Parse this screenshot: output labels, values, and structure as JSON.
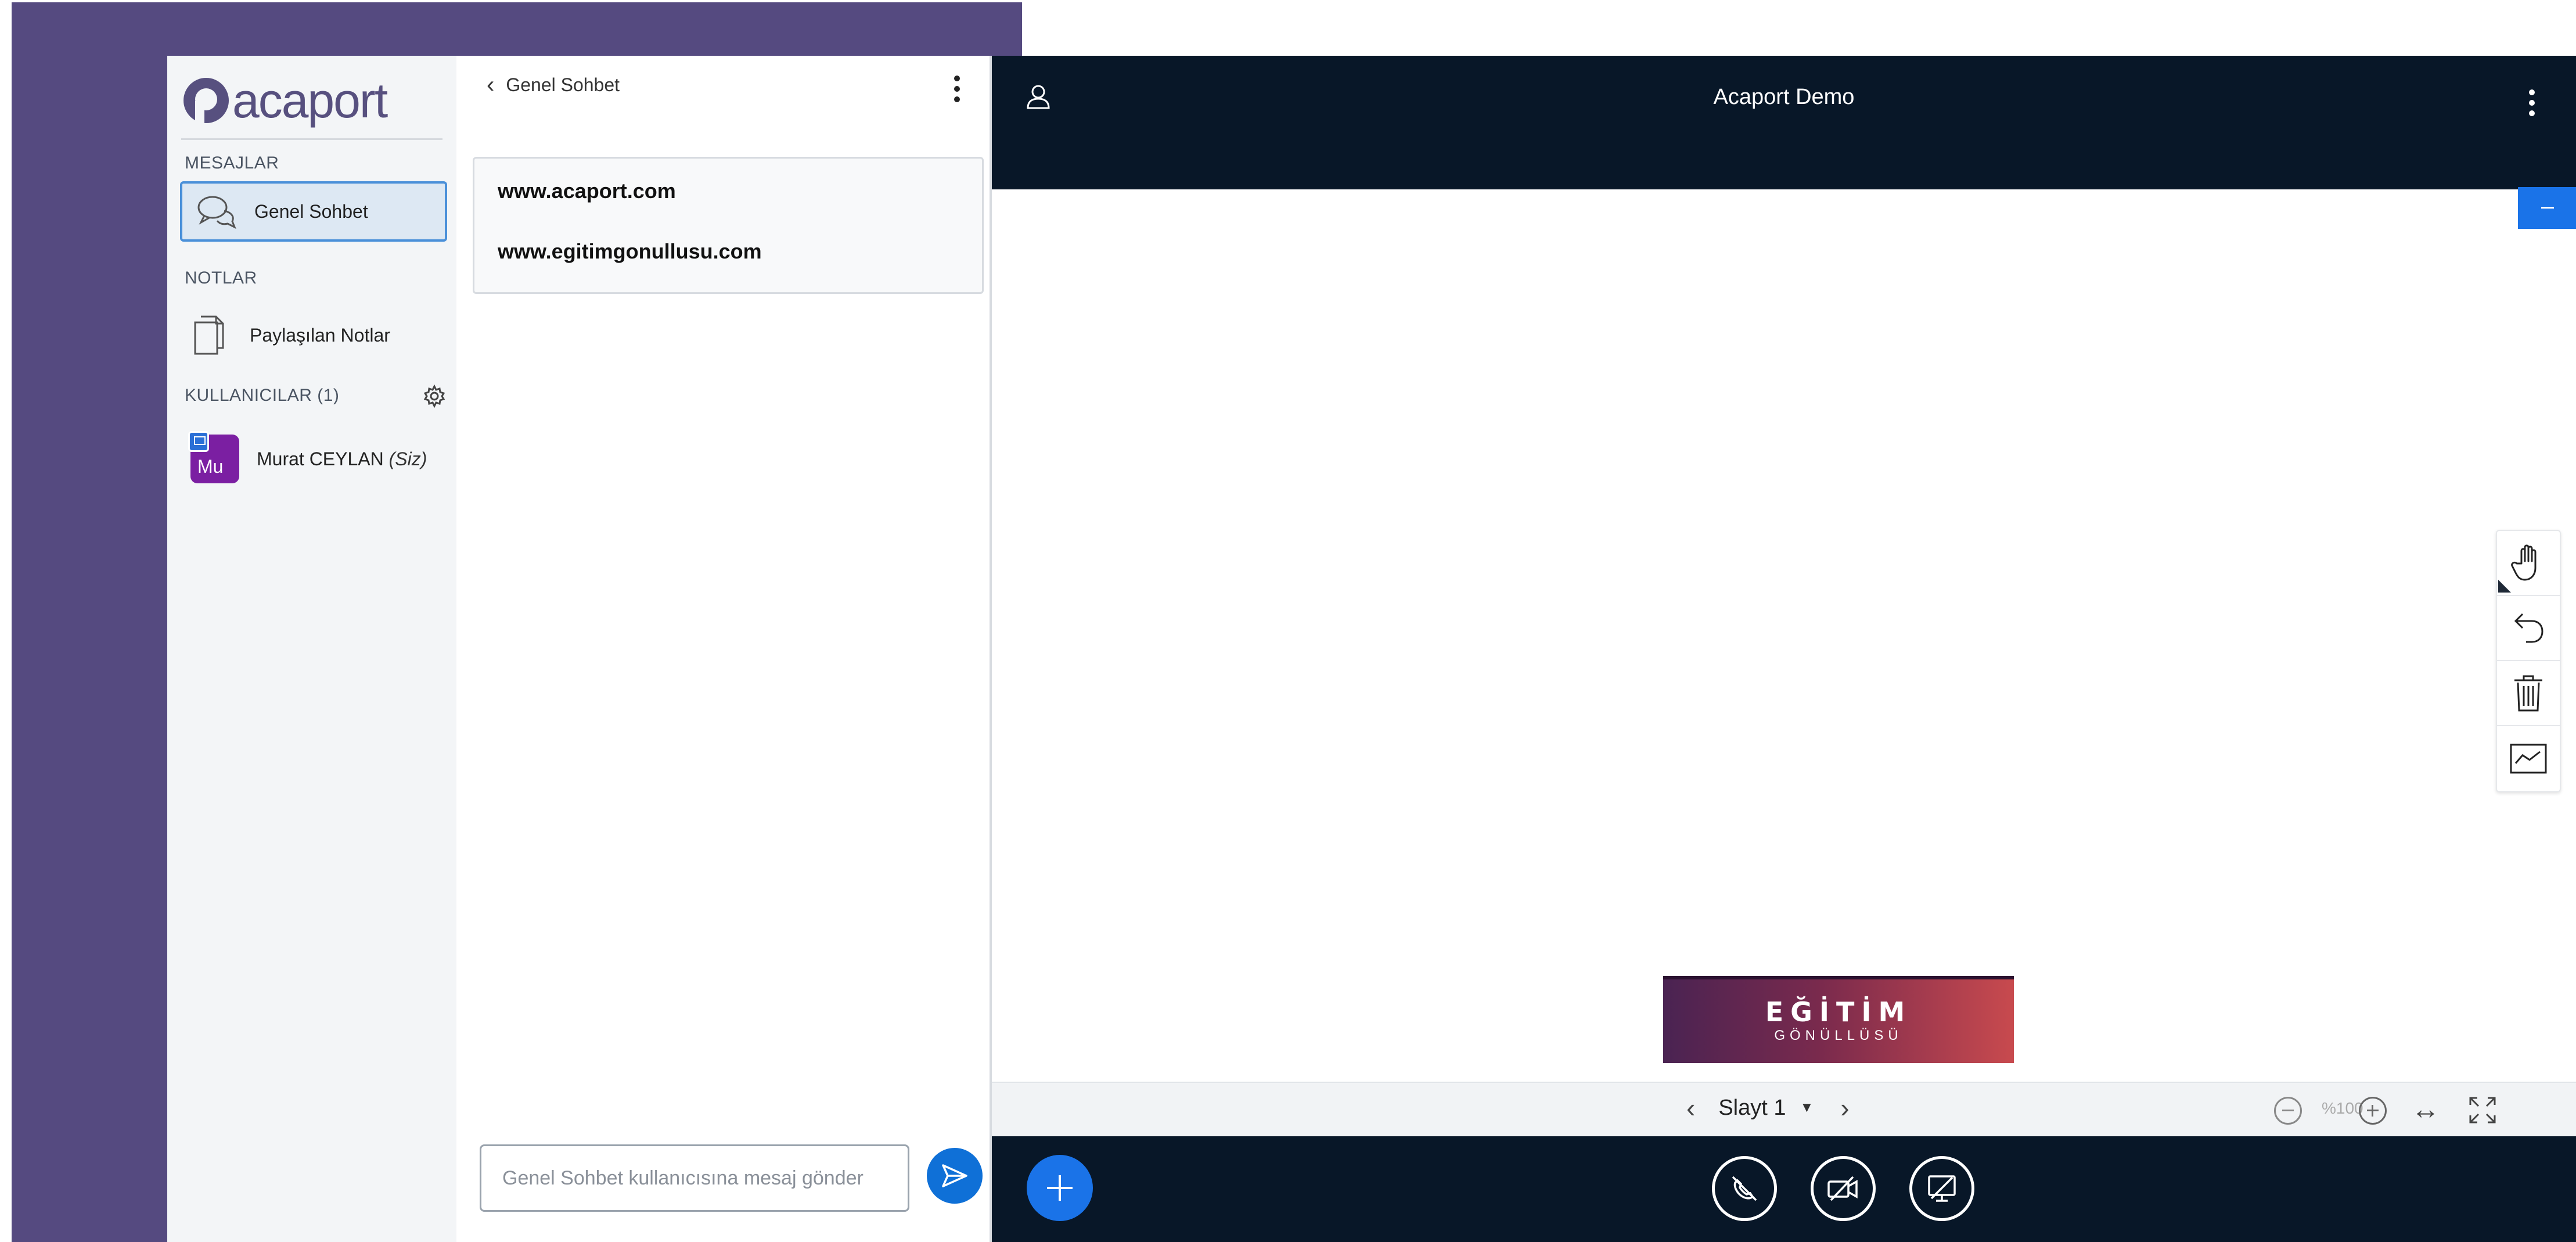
{
  "colors": {
    "purple_background": "#554a80",
    "brand_purple": "#57507f",
    "dark_navy": "#081728",
    "accent_blue": "#1a73e8",
    "active_item_border": "#4a90d9"
  },
  "sidebar": {
    "logo_text": "acaport",
    "sections": {
      "messages": "MESAJLAR",
      "notes": "NOTLAR",
      "users": "KULLANICILAR (1)"
    },
    "items": [
      {
        "label": "Genel Sohbet",
        "icon": "chat-bubbles-icon",
        "active": true
      },
      {
        "label": "Paylaşılan Notlar",
        "icon": "document-icon",
        "active": false
      }
    ],
    "user": {
      "initials": "Mu",
      "name": "Murat CEYLAN",
      "suffix": "(Siz)",
      "avatar_color": "#7b1fa2",
      "presenter_icon": "presenter-icon"
    },
    "settings_icon": "gear-icon"
  },
  "chat": {
    "back_label": "Genel Sohbet",
    "messages": [
      "www.acaport.com",
      "www.egitimgonullusu.com"
    ],
    "input_placeholder": "Genel Sohbet kullanıcısına mesaj gönder",
    "send_icon": "send-icon"
  },
  "presentation": {
    "title": "Acaport Demo",
    "banner_line1": "EĞİTİM",
    "banner_line2": "GÖNÜLLÜSÜ",
    "slide_label": "Slayt 1",
    "zoom_value": "%100",
    "tools": [
      "hand-icon",
      "undo-icon",
      "trash-icon",
      "whiteboard-icon"
    ]
  },
  "controls": {
    "buttons": [
      "audio-muted-icon",
      "camera-off-icon",
      "screenshare-off-icon"
    ]
  }
}
